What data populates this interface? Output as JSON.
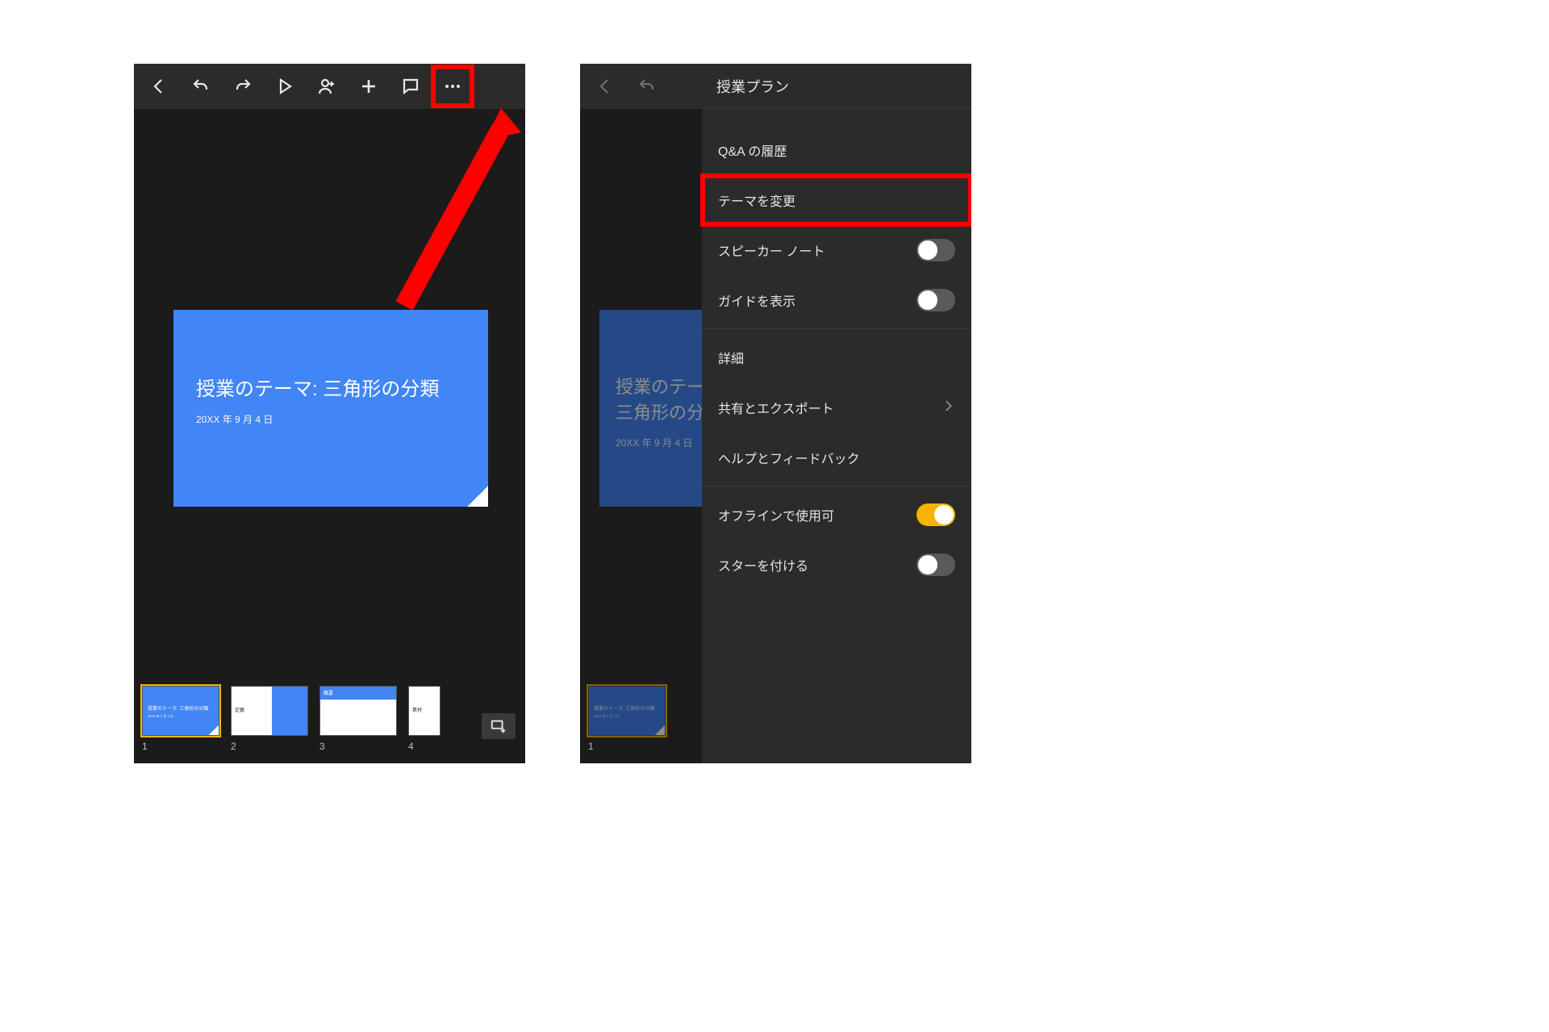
{
  "slide": {
    "title": "授業のテーマ: 三角形の分類",
    "date": "20XX 年 9 月 4 日"
  },
  "thumbnails": {
    "t1": {
      "num": "1",
      "mini_title": "授業のテーマ: 三角形の分類",
      "mini_date": "20XX 年 9 月 4 日"
    },
    "t2": {
      "num": "2",
      "label": "定義"
    },
    "t3": {
      "num": "3",
      "label": "概要"
    },
    "t4": {
      "num": "4",
      "label": "素材"
    }
  },
  "menu": {
    "title": "授業プラン",
    "qa_history": "Q&A の履歴",
    "change_theme": "テーマを変更",
    "speaker_notes": "スピーカー ノート",
    "show_guides": "ガイドを表示",
    "details": "詳細",
    "share_export": "共有とエクスポート",
    "help_feedback": "ヘルプとフィードバック",
    "offline": "オフラインで使用可",
    "star": "スターを付ける"
  },
  "toggles": {
    "speaker_notes": false,
    "show_guides": false,
    "offline": true,
    "star": false
  }
}
